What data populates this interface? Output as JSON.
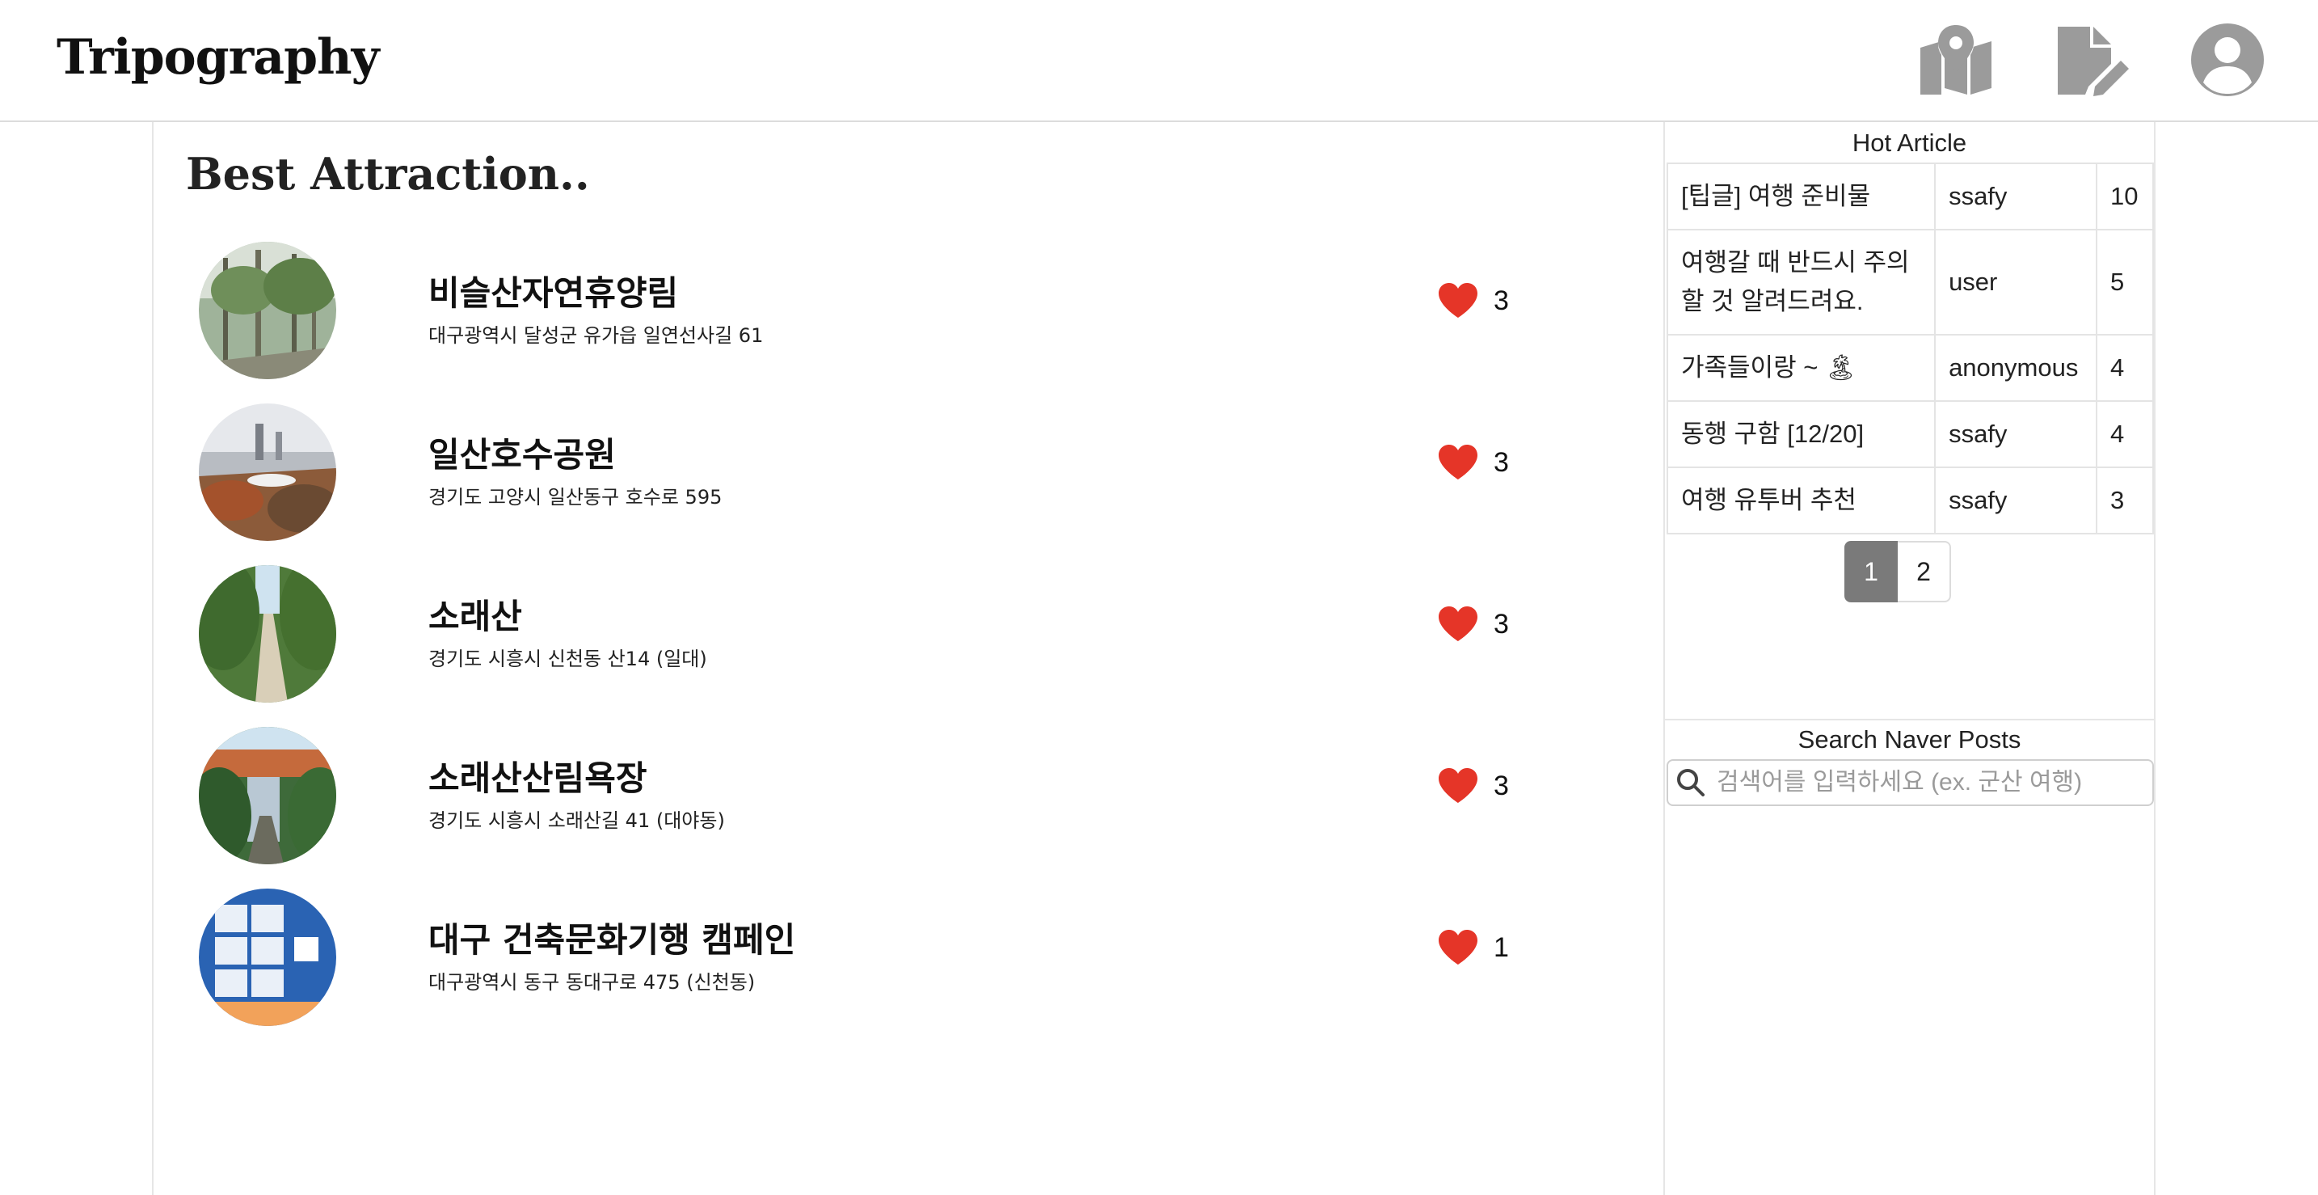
{
  "header": {
    "logo": "Tripography",
    "icons": [
      "map-icon",
      "edit-document-icon",
      "user-icon"
    ]
  },
  "main": {
    "title": "Best Attraction..",
    "attractions": [
      {
        "name": "비슬산자연휴양림",
        "address": "대구광역시 달성군 유가읍 일연선사길 61",
        "likes": "3"
      },
      {
        "name": "일산호수공원",
        "address": "경기도 고양시 일산동구 호수로 595",
        "likes": "3"
      },
      {
        "name": "소래산",
        "address": "경기도 시흥시 신천동 산14 (일대)",
        "likes": "3"
      },
      {
        "name": "소래산산림욕장",
        "address": "경기도 시흥시 소래산길 41 (대야동)",
        "likes": "3"
      },
      {
        "name": "대구 건축문화기행 캠페인",
        "address": "대구광역시 동구 동대구로 475 (신천동)",
        "likes": "1"
      }
    ]
  },
  "sidebar": {
    "hot_title": "Hot Article",
    "hot_articles": [
      {
        "title": "[팁글] 여행 준비물",
        "author": "ssafy",
        "count": "10"
      },
      {
        "title": "여행갈 때 반드시 주의할 것 알려드려요.",
        "author": "user",
        "count": "5"
      },
      {
        "title": "가족들이랑 ~ 🏝",
        "author": "anonymous",
        "count": "4"
      },
      {
        "title": "동행 구함 [12/20]",
        "author": "ssafy",
        "count": "4"
      },
      {
        "title": "여행 유투버 추천",
        "author": "ssafy",
        "count": "3"
      }
    ],
    "pages": [
      "1",
      "2"
    ],
    "active_page": "1",
    "search_title": "Search Naver Posts",
    "search_placeholder": "검색어를 입력하세요 (ex. 군산 여행)"
  },
  "colors": {
    "heart": "#e53528",
    "icon_gray": "#9b9b9b",
    "active_page_bg": "#7a7a7a"
  }
}
